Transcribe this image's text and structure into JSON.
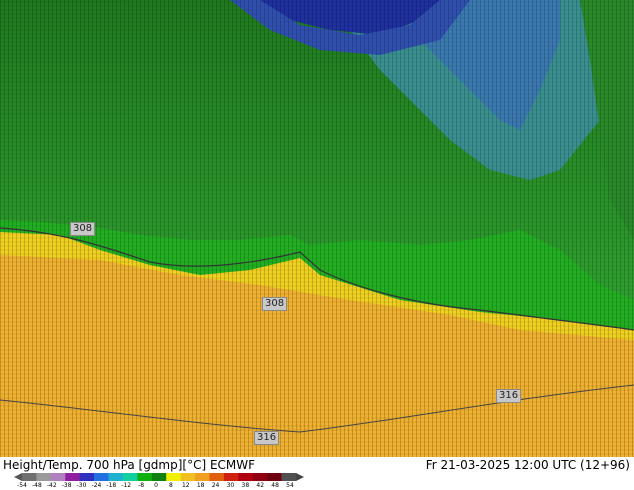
{
  "map": {
    "contour_labels": [
      {
        "id": "c1",
        "text": "308"
      },
      {
        "id": "c2",
        "text": "308"
      },
      {
        "id": "c3",
        "text": "316"
      },
      {
        "id": "c4",
        "text": "316"
      }
    ]
  },
  "footer": {
    "title_left": "Height/Temp. 700 hPa [gdmp][°C] ECMWF",
    "title_right": "Fr 21-03-2025 12:00 UTC (12+96)"
  },
  "legend": {
    "ticks": [
      "-54",
      "-48",
      "-42",
      "-38",
      "-30",
      "-24",
      "-18",
      "-12",
      "-8",
      "0",
      "8",
      "12",
      "18",
      "24",
      "30",
      "38",
      "42",
      "48",
      "54"
    ],
    "colors": [
      "#707070",
      "#9a9a9a",
      "#b080c0",
      "#9020a0",
      "#3030c0",
      "#2070e0",
      "#20b0d0",
      "#10d0a0",
      "#10b010",
      "#108010",
      "#f0f000",
      "#f0c020",
      "#f0a020",
      "#e06010",
      "#d02010",
      "#b00010",
      "#900010",
      "#700010",
      "#505050"
    ]
  }
}
